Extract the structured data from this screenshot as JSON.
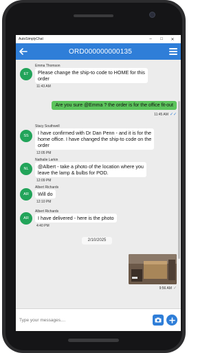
{
  "window": {
    "app_title": "AutoSimplyChat",
    "minimize": "–",
    "maximize": "□",
    "close": "✕"
  },
  "appbar": {
    "back_icon": "arrow-left-icon",
    "title": "ORD000000000135",
    "menu_icon": "hamburger-menu-icon",
    "color": "#2f7ed8"
  },
  "messages": [
    {
      "type": "incoming",
      "initials": "ET",
      "sender": "Emma Thomson",
      "lines": [
        "Please change the ship-to code to HOME for this",
        "order"
      ],
      "time": "11:43 AM"
    },
    {
      "type": "outgoing",
      "text": "Are you sure @Emma ? the order is for the office fit-out",
      "time": "11:45 AM",
      "status": "✓✓"
    },
    {
      "type": "incoming",
      "initials": "SS",
      "sender": "Stacy Southwell",
      "lines": [
        "I have confirmed with Dr Dan Penn - and it is for the",
        "home office.  I have changed the ship-to code on the",
        "order"
      ],
      "time": "12:05 PM"
    },
    {
      "type": "incoming",
      "initials": "NL",
      "sender": "Nathalie Larkin",
      "lines": [
        "@Albert - take a photo of the location where you",
        "leave the lamp & bulbs for POD."
      ],
      "time": "12:09 PM"
    },
    {
      "type": "incoming",
      "initials": "AR",
      "sender": "Albert Richards",
      "lines": [
        "Will do"
      ],
      "time": "12:10 PM"
    },
    {
      "type": "incoming",
      "initials": "AR",
      "sender": "Albert Richards",
      "lines": [
        "I have delivered - here is the photo"
      ],
      "time": "4:40 PM"
    }
  ],
  "date_separator": "2/10/2025",
  "photo_message": {
    "time": "9:56 AM",
    "status": "✓"
  },
  "composer": {
    "placeholder": "Type your messages....",
    "camera_icon": "camera-icon",
    "add_icon": "plus-icon"
  },
  "colors": {
    "avatar": "#22a45a",
    "outgoing_bubble": "#5cc45c",
    "chat_background": "#ececec"
  }
}
